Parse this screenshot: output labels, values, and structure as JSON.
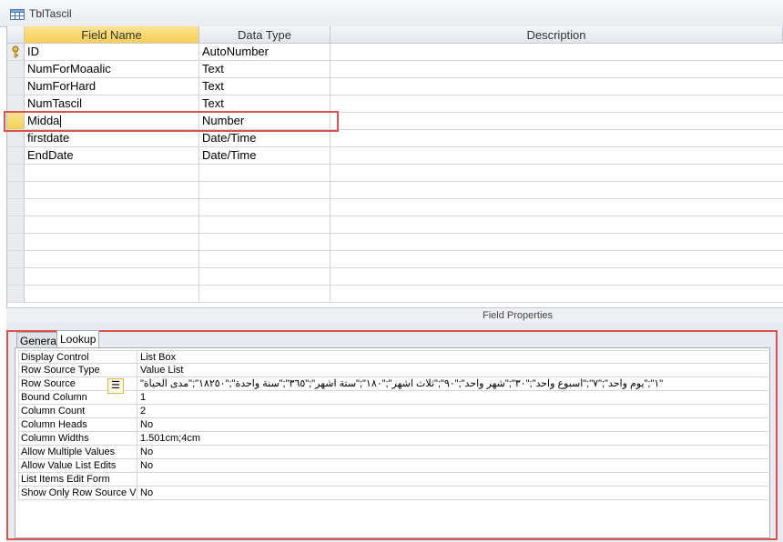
{
  "window": {
    "title": "TblTascil"
  },
  "grid": {
    "headers": {
      "field_name": "Field Name",
      "data_type": "Data Type",
      "description": "Description"
    },
    "rows": [
      {
        "name": "ID",
        "type": "AutoNumber",
        "primary_key": true
      },
      {
        "name": "NumForMoaalic",
        "type": "Text"
      },
      {
        "name": "NumForHard",
        "type": "Text"
      },
      {
        "name": "NumTascil",
        "type": "Text"
      },
      {
        "name": "Midda",
        "type": "Number",
        "current": true
      },
      {
        "name": "firstdate",
        "type": "Date/Time"
      },
      {
        "name": "EndDate",
        "type": "Date/Time"
      }
    ],
    "empty_rows": 9
  },
  "field_properties": {
    "label": "Field Properties",
    "tabs": {
      "general": "General",
      "lookup": "Lookup"
    },
    "active_tab": "Lookup",
    "properties": [
      {
        "label": "Display Control",
        "value": "List Box"
      },
      {
        "label": "Row Source Type",
        "value": "Value List"
      },
      {
        "label": "Row Source",
        "value": "\"١\";\"يوم واحد\";\"٧\";\"اسبوع واحد\";\"٣٠\";\"شهر واحد\";\"٩٠\";\"ثلاث اشهر\";\"١٨٠\";\"ستة اشهر\";\"٣٦٥\";\"سنة واحدة\";\"١٨٢٥٠\";\"مدى الحياة\""
      },
      {
        "label": "Bound Column",
        "value": "1"
      },
      {
        "label": "Column Count",
        "value": "2"
      },
      {
        "label": "Column Heads",
        "value": "No"
      },
      {
        "label": "Column Widths",
        "value": "1.501cm;4cm"
      },
      {
        "label": "Allow Multiple Values",
        "value": "No"
      },
      {
        "label": "Allow Value List Edits",
        "value": "No"
      },
      {
        "label": "List Items Edit Form",
        "value": ""
      },
      {
        "label": "Show Only Row Source V",
        "value": "No"
      }
    ]
  },
  "colors": {
    "highlight_border": "#d9534f",
    "selected_header": "#f6cf56"
  }
}
